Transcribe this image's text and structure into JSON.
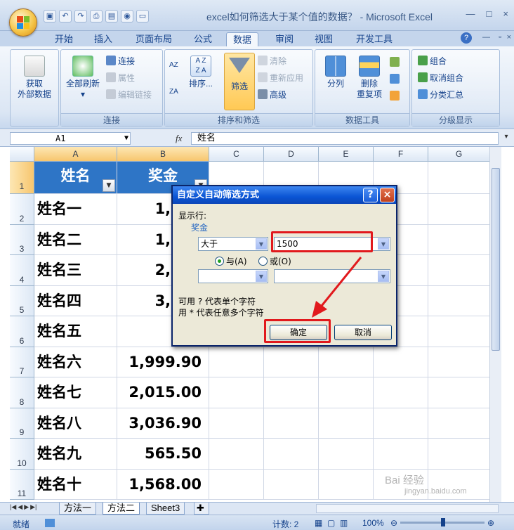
{
  "window": {
    "title": "excel如何筛选大于某个值的数据？ - Microsoft Excel",
    "controls": [
      "—",
      "□",
      "×"
    ]
  },
  "ribbon": {
    "tabs": [
      "开始",
      "插入",
      "页面布局",
      "公式",
      "数据",
      "审阅",
      "视图",
      "开发工具"
    ],
    "active_tab": "数据",
    "groups": {
      "external": {
        "label_1": "获取",
        "label_2": "外部数据"
      },
      "connections": {
        "title": "连接",
        "refresh_label_1": "全部刷新",
        "connection": "连接",
        "properties": "属性",
        "edit_links": "编辑链接"
      },
      "sort_filter": {
        "title": "排序和筛选",
        "sort": "排序...",
        "filter": "筛选",
        "clear": "清除",
        "reapply": "重新应用",
        "advanced": "高级",
        "az": "AZ",
        "za": "ZA"
      },
      "data_tools": {
        "title": "数据工具",
        "text_to_columns": "分列",
        "remove_dup_1": "删除",
        "remove_dup_2": "重复项"
      },
      "outline": {
        "title": "分级显示",
        "group": "组合",
        "ungroup": "取消组合",
        "subtotal": "分类汇总"
      }
    }
  },
  "formula_bar": {
    "name_box": "A1",
    "fx": "fx",
    "content": "姓名"
  },
  "grid": {
    "columns": [
      "A",
      "B",
      "C",
      "D",
      "E",
      "F",
      "G"
    ],
    "header": {
      "name": "姓名",
      "bonus": "奖金"
    },
    "rows": [
      {
        "num": "1"
      },
      {
        "num": "2",
        "name": "姓名一",
        "bonus": "1,234"
      },
      {
        "num": "3",
        "name": "姓名二",
        "bonus": "1,265"
      },
      {
        "num": "4",
        "name": "姓名三",
        "bonus": "2,088"
      },
      {
        "num": "5",
        "name": "姓名四",
        "bonus": "3,156"
      },
      {
        "num": "6",
        "name": "姓名五",
        "bonus": "988"
      },
      {
        "num": "7",
        "name": "姓名六",
        "bonus": "1,999.90"
      },
      {
        "num": "8",
        "name": "姓名七",
        "bonus": "2,015.00"
      },
      {
        "num": "9",
        "name": "姓名八",
        "bonus": "3,036.90"
      },
      {
        "num": "10",
        "name": "姓名九",
        "bonus": "565.50"
      },
      {
        "num": "11",
        "name": "姓名十",
        "bonus": "1,568.00"
      }
    ]
  },
  "dialog": {
    "title": "自定义自动筛选方式",
    "help": "?",
    "close": "×",
    "show_rows": "显示行:",
    "field": "奖金",
    "operator1": "大于",
    "value1": "1500",
    "operator2": "",
    "value2": "",
    "and_label": "与(A)",
    "or_label": "或(O)",
    "hint1": "可用 ? 代表单个字符",
    "hint2": "用 * 代表任意多个字符",
    "ok": "确定",
    "cancel": "取消"
  },
  "sheets": {
    "tabs": [
      "方法一",
      "方法二",
      "Sheet3"
    ],
    "active": "方法二"
  },
  "status": {
    "ready": "就绪",
    "count": "计数: 2",
    "zoom": "100%"
  },
  "watermark": {
    "line1": "Bai 经验",
    "line2": "jingyan.baidu.com"
  }
}
